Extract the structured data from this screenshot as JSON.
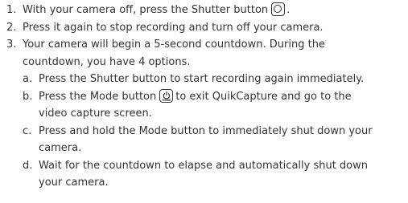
{
  "steps": [
    {
      "num": "1.",
      "text_before_icon": "With your camera off, press the Shutter button",
      "icon": "shutter-button-icon",
      "text_after_icon": "."
    },
    {
      "num": "2.",
      "text": "Press it again to stop recording and turn off your camera."
    },
    {
      "num": "3.",
      "line1": "Your camera will begin a 5-second countdown. During the",
      "line2": "countdown, you have 4 options."
    }
  ],
  "options": [
    {
      "letter": "a.",
      "text": "Press the Shutter button to start recording again immediately."
    },
    {
      "letter": "b.",
      "text_before_icon": "Press the Mode button",
      "icon": "mode-button-icon",
      "text_after_icon": "to exit QuikCapture and go to the",
      "line2": "video capture screen."
    },
    {
      "letter": "c.",
      "line1": "Press and hold the Mode button to immediately shut down your",
      "line2": "camera."
    },
    {
      "letter": "d.",
      "line1": "Wait for the countdown to elapse and automatically shut down",
      "line2": "your camera."
    }
  ],
  "icons": {
    "mode_label": "MODE"
  }
}
